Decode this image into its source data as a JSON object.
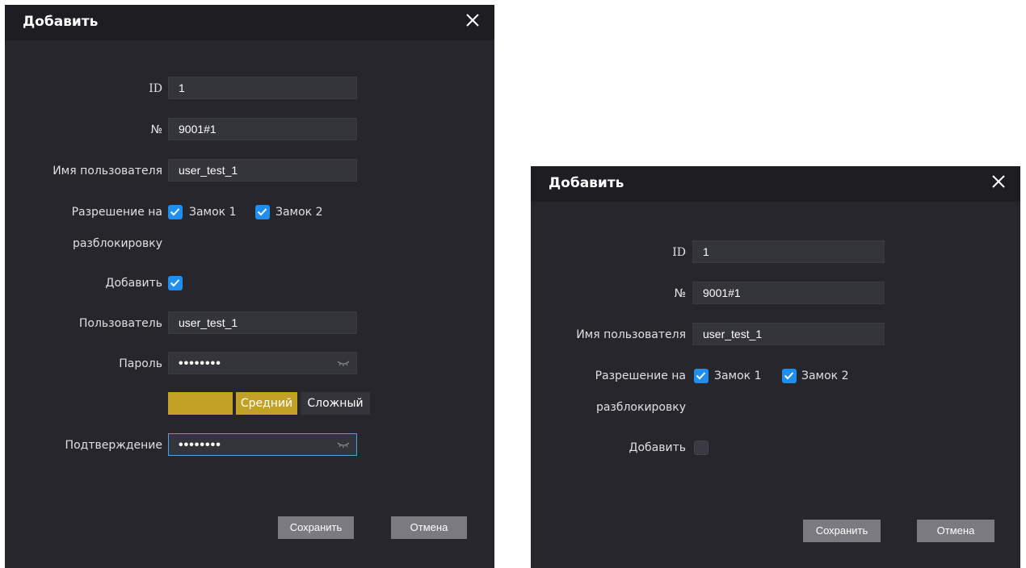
{
  "left_dialog": {
    "title": "Добавить",
    "fields": {
      "id_label": "ID",
      "id_value": "1",
      "number_label": "№",
      "number_value": "9001#1",
      "username_label": "Имя пользователя",
      "username_value": "user_test_1",
      "permission_label_line1": "Разрешение на",
      "permission_label_line2": "разблокировку",
      "lock1_label": "Замок 1",
      "lock2_label": "Замок 2",
      "add_label": "Добавить",
      "user_label": "Пользователь",
      "user_value": "user_test_1",
      "password_label": "Пароль",
      "password_value": "••••••••",
      "confirm_label": "Подтверждение",
      "confirm_value": "••••••••"
    },
    "strength": {
      "medium_label": "Средний",
      "complex_label": "Сложный"
    },
    "buttons": {
      "save": "Сохранить",
      "cancel": "Отмена"
    }
  },
  "right_dialog": {
    "title": "Добавить",
    "fields": {
      "id_label": "ID",
      "id_value": "1",
      "number_label": "№",
      "number_value": "9001#1",
      "username_label": "Имя пользователя",
      "username_value": "user_test_1",
      "permission_label_line1": "Разрешение на",
      "permission_label_line2": "разблокировку",
      "lock1_label": "Замок 1",
      "lock2_label": "Замок 2",
      "add_label": "Добавить"
    },
    "buttons": {
      "save": "Сохранить",
      "cancel": "Отмена"
    }
  },
  "colors": {
    "dialog_bg": "#26262c",
    "header_bg": "#1d1d22",
    "checkbox_accent": "#1f8ef1",
    "strength_accent": "#c3a126",
    "button_bg": "#7a7a80"
  }
}
